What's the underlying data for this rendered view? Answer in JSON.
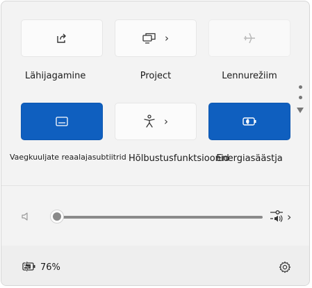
{
  "quick_settings": {
    "tiles": [
      {
        "id": "nearby-sharing",
        "label": "Lähijagamine",
        "state": "off",
        "icon": "share-icon",
        "has_chevron": false
      },
      {
        "id": "project",
        "label": "Project",
        "state": "off",
        "icon": "project-icon",
        "has_chevron": true
      },
      {
        "id": "airplane",
        "label": "Lennurežiim",
        "state": "disabled",
        "icon": "airplane-icon",
        "has_chevron": false
      },
      {
        "id": "live-captions",
        "label": "Vaegkuuljate reaalajasubtiitrid",
        "state": "on",
        "icon": "captions-icon",
        "has_chevron": false
      },
      {
        "id": "accessibility",
        "label": "Hõlbustusfunktsioonid",
        "state": "off",
        "icon": "accessibility-icon",
        "has_chevron": true
      },
      {
        "id": "energy-saver",
        "label": "Energiasäästja",
        "state": "on",
        "icon": "energy-saver-icon",
        "has_chevron": false
      }
    ]
  },
  "volume": {
    "level_percent": 0,
    "icon": "speaker-muted-icon",
    "mixer_icon": "audio-mixer-icon"
  },
  "battery": {
    "percent_text": "76%",
    "icon": "battery-charging-icon"
  },
  "settings_icon": "gear-icon",
  "colors": {
    "accent": "#0f5fbf",
    "panel_bg": "#f3f3f3",
    "tile_bg": "#fbfbfb"
  }
}
